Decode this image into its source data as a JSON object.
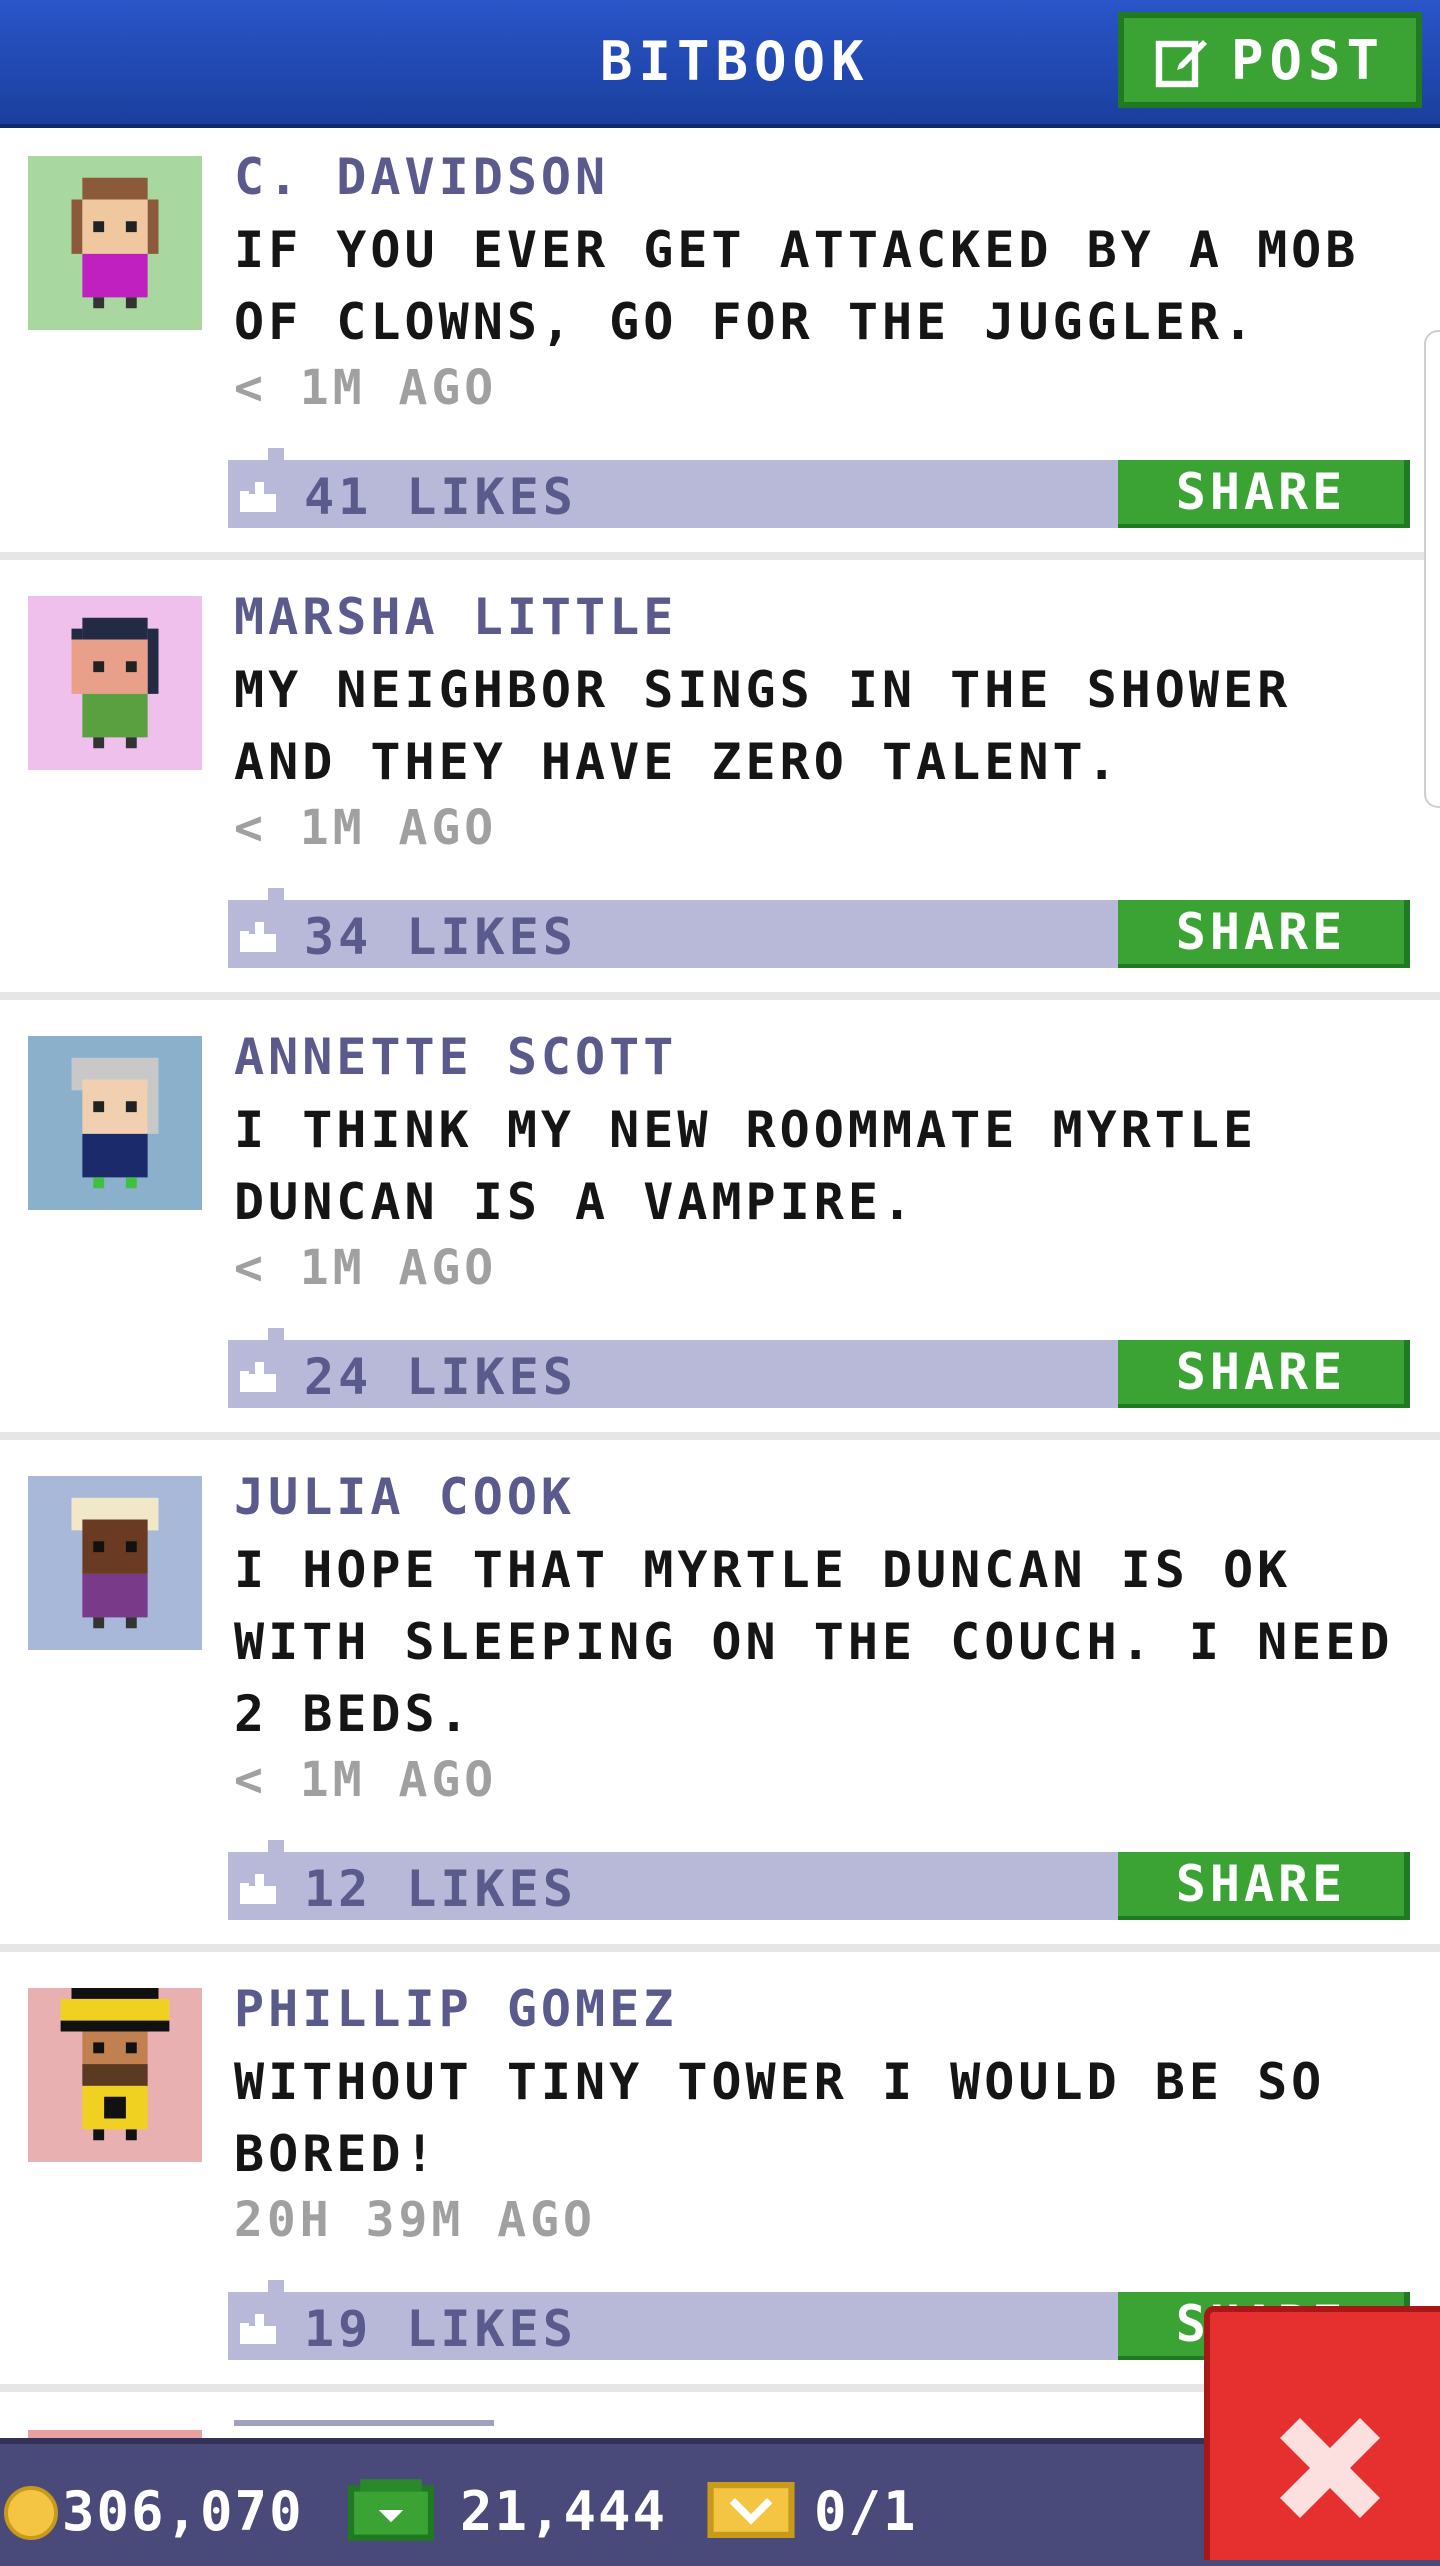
{
  "header": {
    "title": "BITBOOK",
    "post_label": "POST",
    "post_icon": "edit-icon"
  },
  "posts": [
    {
      "author": "C. DAVIDSON",
      "message": "IF YOU EVER GET ATTACKED BY A MOB OF CLOWNS, GO FOR THE JUGGLER.",
      "time": "< 1M AGO",
      "likes": "41 LIKES",
      "share": "SHARE",
      "avatar_bg": "#a8d8a0"
    },
    {
      "author": "MARSHA LITTLE",
      "message": "MY NEIGHBOR SINGS IN THE SHOWER AND THEY HAVE ZERO TALENT.",
      "time": "< 1M AGO",
      "likes": "34 LIKES",
      "share": "SHARE",
      "avatar_bg": "#f0c0ec"
    },
    {
      "author": "ANNETTE SCOTT",
      "message": "I THINK MY NEW ROOMMATE MYRTLE DUNCAN IS A VAMPIRE.",
      "time": "< 1M AGO",
      "likes": "24 LIKES",
      "share": "SHARE",
      "avatar_bg": "#8ab0cc"
    },
    {
      "author": "JULIA COOK",
      "message": "I HOPE THAT MYRTLE DUNCAN IS OK WITH SLEEPING ON THE COUCH. I NEED 2 BEDS.",
      "time": "< 1M AGO",
      "likes": "12 LIKES",
      "share": "SHARE",
      "avatar_bg": "#a8b8d8"
    },
    {
      "author": "PHILLIP GOMEZ",
      "message": "WITHOUT TINY TOWER I WOULD BE SO BORED!",
      "time": "20H 39M AGO",
      "likes": "19 LIKES",
      "share": "SHARE",
      "avatar_bg": "#e8b0b0"
    }
  ],
  "status_bar": {
    "coins": "306,070",
    "bux": "21,444",
    "tickets": "0/1"
  },
  "colors": {
    "header": "#2a55c9",
    "accent_green": "#3aa334",
    "like_bar": "#b8b8d8",
    "close_red": "#e63030"
  }
}
